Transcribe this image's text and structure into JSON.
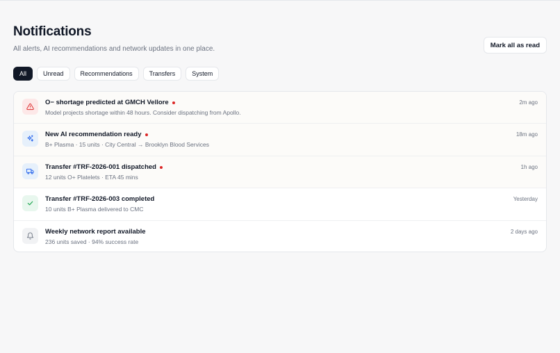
{
  "header": {
    "title": "Notifications",
    "subtitle": "All alerts, AI recommendations and network updates in one place.",
    "mark_all_label": "Mark all as read"
  },
  "tabs": [
    {
      "label": "All",
      "active": true
    },
    {
      "label": "Unread",
      "active": false
    },
    {
      "label": "Recommendations",
      "active": false
    },
    {
      "label": "Transfers",
      "active": false
    },
    {
      "label": "System",
      "active": false
    }
  ],
  "notifications": [
    {
      "title": "O− shortage predicted at GMCH Vellore",
      "description": "Model projects shortage within 48 hours. Consider dispatching from Apollo.",
      "time": "2m ago",
      "unread": true,
      "icon": "alert-triangle-icon",
      "icon_bg": "#fde8e8",
      "icon_color": "#dc2626"
    },
    {
      "title": "New AI recommendation ready",
      "description": "B+ Plasma · 15 units · City Central → Brooklyn Blood Services",
      "time": "18m ago",
      "unread": true,
      "icon": "sparkles-icon",
      "icon_bg": "#e6f0fb",
      "icon_color": "#2563eb"
    },
    {
      "title": "Transfer #TRF-2026-001 dispatched",
      "description": "12 units O+ Platelets · ETA 45 mins",
      "time": "1h ago",
      "unread": true,
      "icon": "truck-icon",
      "icon_bg": "#e6f0fb",
      "icon_color": "#2563eb"
    },
    {
      "title": "Transfer #TRF-2026-003 completed",
      "description": "10 units B+ Plasma delivered to CMC",
      "time": "Yesterday",
      "unread": false,
      "icon": "check-icon",
      "icon_bg": "#e8f7ee",
      "icon_color": "#16a34a"
    },
    {
      "title": "Weekly network report available",
      "description": "236 units saved · 94% success rate",
      "time": "2 days ago",
      "unread": false,
      "icon": "bell-icon",
      "icon_bg": "#f1f2f4",
      "icon_color": "#6b7280"
    }
  ],
  "colors": {
    "unread_dot": "#dc2626",
    "active_tab_bg": "#111827"
  }
}
